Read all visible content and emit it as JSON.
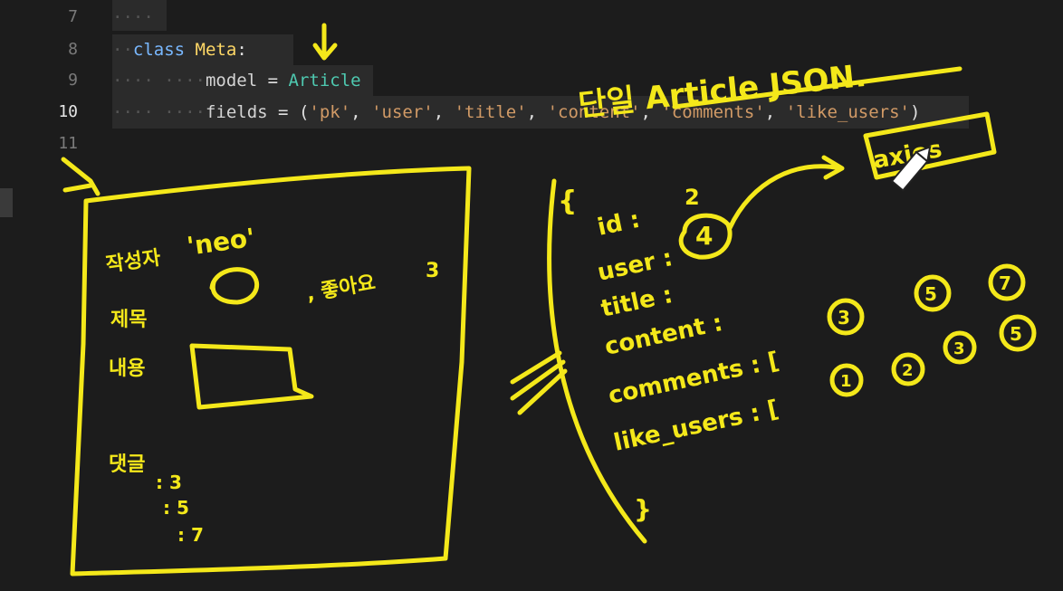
{
  "editor": {
    "lines": [
      {
        "number": "7"
      },
      {
        "number": "8",
        "kw": "class",
        "name": "Meta",
        "colon": ":"
      },
      {
        "number": "9",
        "attr": "model",
        "eq": "=",
        "value": "Article"
      },
      {
        "number": "10",
        "attr": "fields",
        "eq": "=",
        "open": "(",
        "s1": "'pk'",
        "s2": "'user'",
        "s3": "'title'",
        "s4": "'content'",
        "s5": "'comments'",
        "s6": "'like_users'",
        "close": ")"
      },
      {
        "number": "11"
      }
    ]
  },
  "annotations": {
    "title": "단일 Article JSON.",
    "axios": "axios",
    "left_box": {
      "writer_label": "작성자",
      "writer_value": "'neo'",
      "title_label": "제목",
      "like_label": ", 좋아요",
      "like_count": "3",
      "content_label": "내용",
      "comments_label": "댓글",
      "comment_ids": [
        ": 3",
        ": 5",
        ": 7"
      ]
    },
    "json": {
      "open_brace": "{",
      "close_brace": "}",
      "id_label": "id :",
      "id_value": "2",
      "user_label": "user :",
      "user_value": "4",
      "title_label": "title :",
      "content_label": "content :",
      "comments_label": "comments : [",
      "comments_values": [
        "3",
        "5",
        "7"
      ],
      "like_users_label": "like_users : [",
      "like_users_values": [
        "1",
        "2",
        "3",
        "5"
      ]
    }
  },
  "colors": {
    "background": "#1c1c1c",
    "ink": "#f4e81a",
    "keyword": "#79b8ff",
    "string": "#d19a66",
    "type": "#4ec9b0"
  }
}
